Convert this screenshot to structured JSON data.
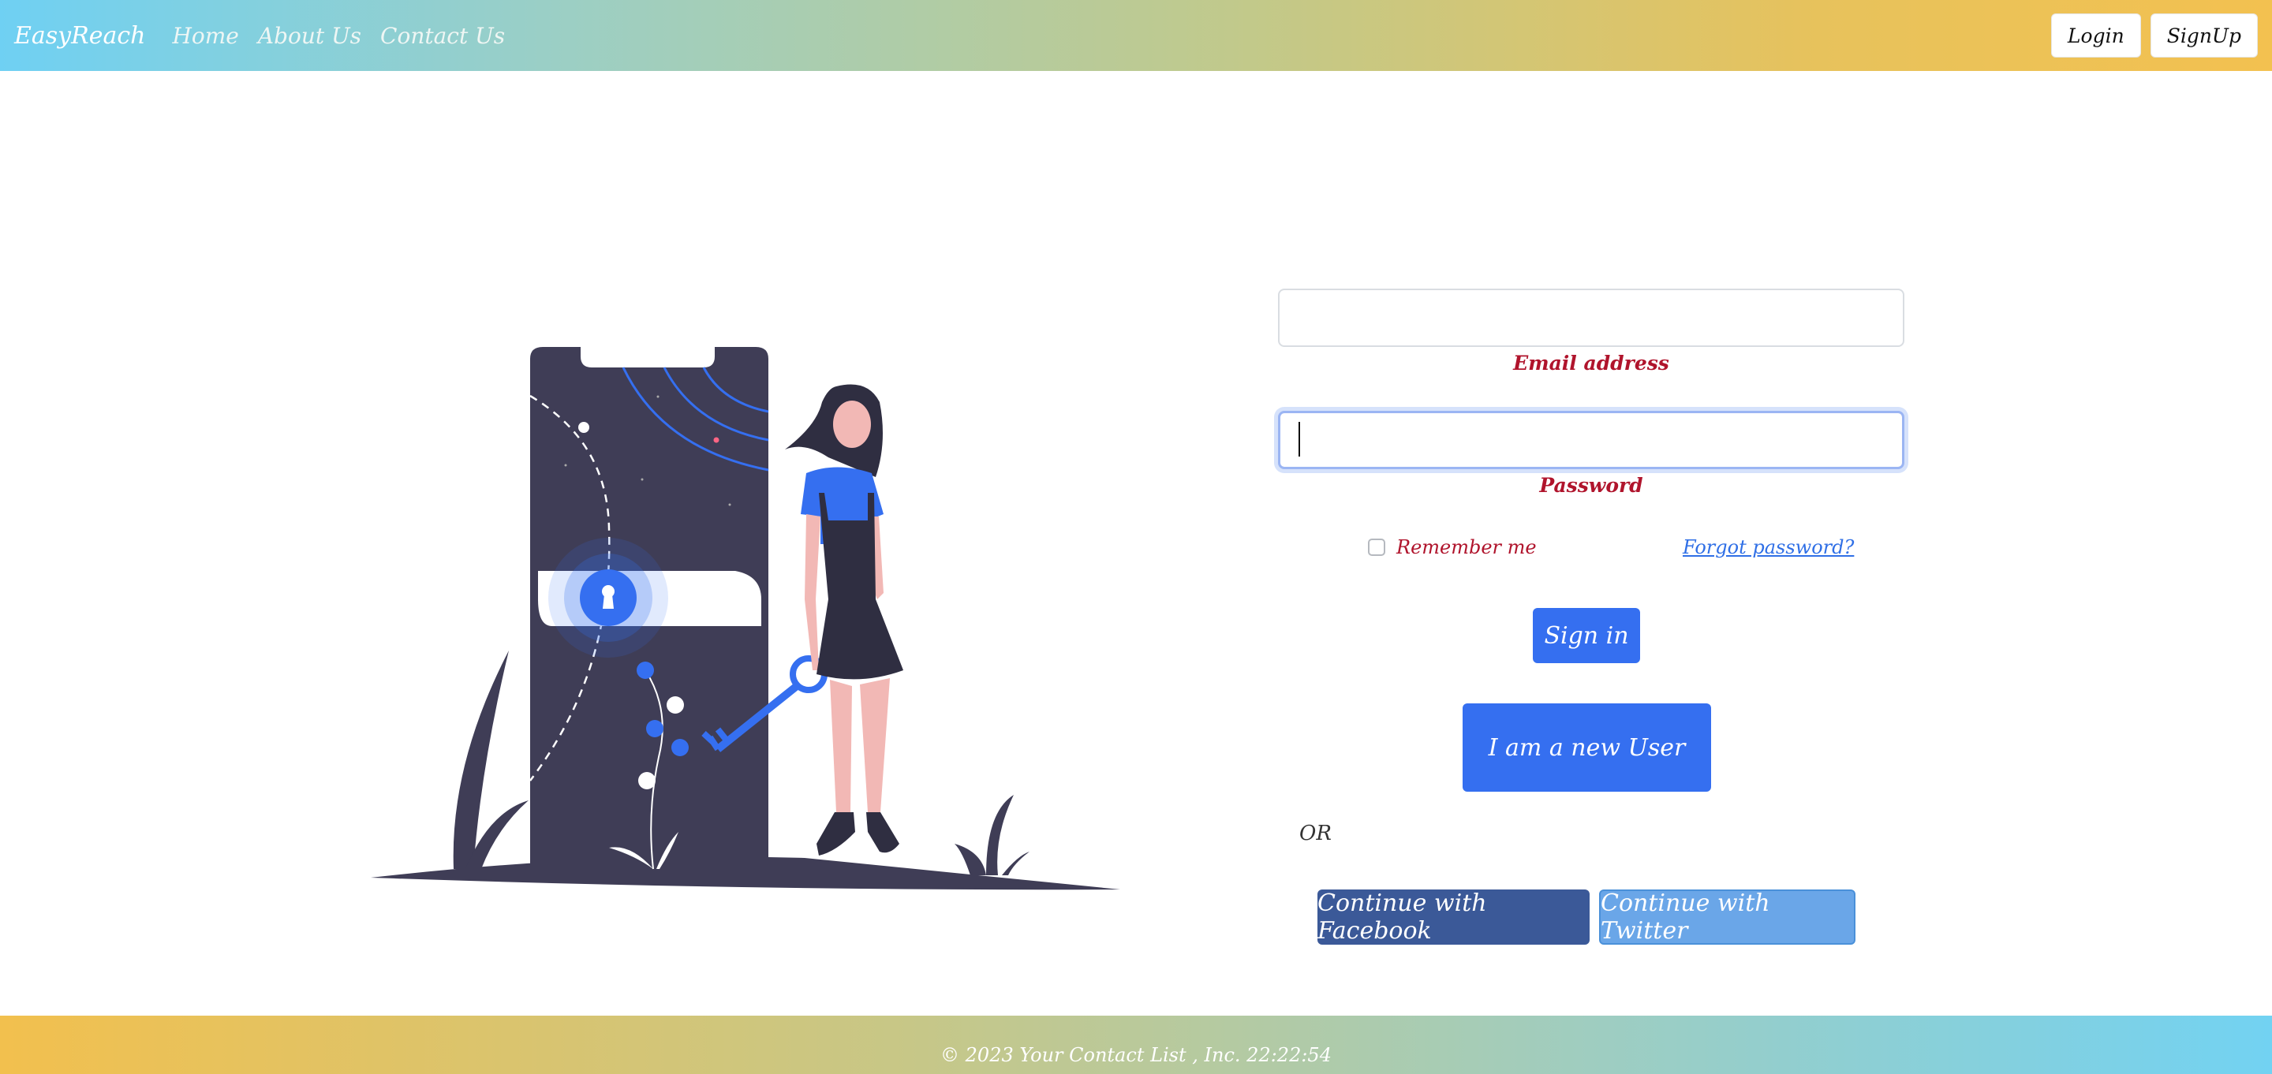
{
  "navbar": {
    "brand": "EasyReach",
    "links": [
      "Home",
      "About Us",
      "Contact Us"
    ],
    "login_label": "Login",
    "signup_label": "SignUp"
  },
  "form": {
    "email": {
      "value": "",
      "label": "Email address"
    },
    "password": {
      "value": "",
      "label": "Password"
    },
    "remember_label": "Remember me",
    "forgot_label": "Forgot password?",
    "signin_label": "Sign in",
    "new_user_label": "I am a new User",
    "or_label": "OR",
    "facebook_label": "Continue with Facebook",
    "twitter_label": "Continue with Twitter"
  },
  "footer": {
    "text": "© 2023 Your Contact List , Inc. 22:22:54"
  },
  "colors": {
    "primary": "#356ff0",
    "facebook": "#3b5998",
    "twitter": "#6aa6e8",
    "label_red": "#b0142c",
    "illustration_dark": "#3f3d56"
  }
}
